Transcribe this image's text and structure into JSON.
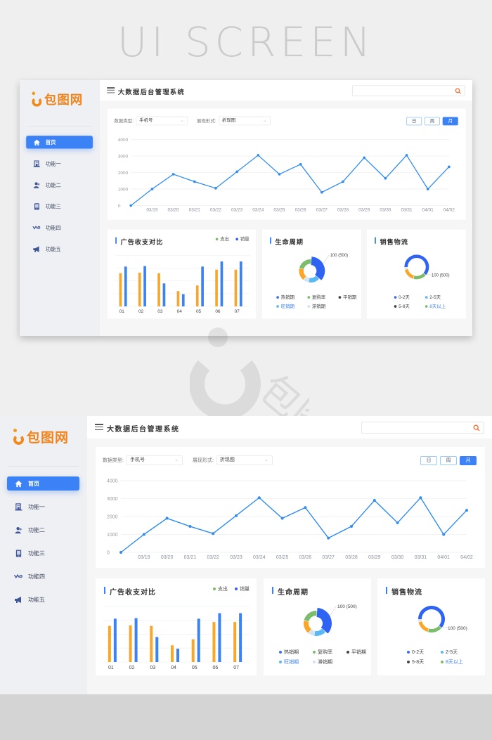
{
  "hero": {
    "title": "UI SCREEN"
  },
  "brand": {
    "name": "包图网",
    "color": "#f0841d"
  },
  "header": {
    "title": "大数据后台管理系统",
    "search_placeholder": "",
    "search_value": ""
  },
  "sidebar": {
    "items": [
      {
        "label": "首页",
        "icon": "home-icon",
        "active": true
      },
      {
        "label": "功能一",
        "icon": "building-icon",
        "active": false
      },
      {
        "label": "功能二",
        "icon": "users-icon",
        "active": false
      },
      {
        "label": "功能三",
        "icon": "tablet-icon",
        "active": false
      },
      {
        "label": "功能四",
        "icon": "wave-icon",
        "active": false
      },
      {
        "label": "功能五",
        "icon": "megaphone-icon",
        "active": false
      }
    ]
  },
  "filters": {
    "data_type_label": "数据类型:",
    "data_type_value": "手机号",
    "display_label": "展现形式:",
    "display_value": "折现图"
  },
  "range_tabs": [
    {
      "label": "日",
      "active": false
    },
    {
      "label": "周",
      "active": false
    },
    {
      "label": "月",
      "active": true
    }
  ],
  "colors": {
    "primary": "#3b82f6",
    "line": "#2f8cf0",
    "orange": "#f9a72b",
    "green": "#7bbd6b",
    "light_blue": "#5ab8f5",
    "pale_blue": "#cfe4f8",
    "dark": "#444444"
  },
  "cards": {
    "bars": {
      "title": "广告收支对比",
      "legend": [
        {
          "label": "支出",
          "color": "#7bbd6b"
        },
        {
          "label": "销量",
          "color": "#3b5bf6"
        }
      ]
    },
    "life": {
      "title": "生命周期",
      "callout": "100",
      "callout_total": "(500)",
      "legend": [
        {
          "label": "热销期",
          "color": "#3b6ff6",
          "highlight": false
        },
        {
          "label": "复购率",
          "color": "#7bbd6b",
          "highlight": false
        },
        {
          "label": "平销期",
          "color": "#444444",
          "highlight": false
        },
        {
          "label": "旺销期",
          "color": "#5ab8f5",
          "highlight": true
        },
        {
          "label": "滞销期",
          "color": "#cfe0f4",
          "highlight": false
        }
      ]
    },
    "logi": {
      "title": "销售物流",
      "callout": "100",
      "callout_total": "(500)",
      "legend": [
        {
          "label": "0-2天",
          "color": "#3b6ff6",
          "highlight": false
        },
        {
          "label": "2-5天",
          "color": "#5ab8f5",
          "highlight": false
        },
        {
          "label": "5-8天",
          "color": "#444444",
          "highlight": false
        },
        {
          "label": "8天以上",
          "color": "#7bbd6b",
          "highlight": true
        }
      ]
    }
  },
  "chart_data": [
    {
      "type": "line",
      "title": "",
      "xlabel": "",
      "ylabel": "",
      "x": [
        "",
        "03/19",
        "03/20",
        "03/21",
        "03/22",
        "03/23",
        "03/24",
        "03/25",
        "03/26",
        "03/27",
        "03/28",
        "03/29",
        "03/30",
        "03/31",
        "04/01",
        "04/02"
      ],
      "y": [
        0,
        1000,
        1900,
        1450,
        1050,
        2050,
        3050,
        1900,
        2500,
        800,
        1450,
        2900,
        1650,
        3050,
        1000,
        2350
      ],
      "yticks": [
        0,
        1000,
        2000,
        3000,
        4000
      ],
      "ylim": [
        0,
        4000
      ],
      "grid": true
    },
    {
      "type": "bar",
      "title": "广告收支对比",
      "categories": [
        "01",
        "02",
        "03",
        "04",
        "05",
        "06",
        "07"
      ],
      "series": [
        {
          "name": "支出",
          "color": "#f9a72b",
          "values": [
            65,
            66,
            65,
            30,
            41,
            72,
            72
          ]
        },
        {
          "name": "销量",
          "color": "#3b82f6",
          "values": [
            78,
            79,
            45,
            24,
            78,
            88,
            88
          ]
        }
      ],
      "ylim": [
        0,
        100
      ],
      "grid": true,
      "legend": "top-right"
    },
    {
      "type": "pie",
      "title": "生命周期",
      "donut": true,
      "labels": [
        "热销期",
        "旺销期",
        "滞销期",
        "平销期",
        "复购率"
      ],
      "values": [
        36,
        16,
        8,
        18,
        22
      ],
      "colors": [
        "#2f63f3",
        "#5ab8f5",
        "#cfe4f8",
        "#f9a72b",
        "#7bbd6b"
      ],
      "annotation": "100 (500)"
    },
    {
      "type": "pie",
      "title": "销售物流",
      "donut": true,
      "labels": [
        "0-2天",
        "8天以上",
        "5-8天",
        "2-5天"
      ],
      "values": [
        62,
        18,
        17,
        3
      ],
      "colors": [
        "#2f63f3",
        "#7bbd6b",
        "#f9a72b",
        "#cfe4f8"
      ],
      "annotation": "100 (500)"
    }
  ]
}
